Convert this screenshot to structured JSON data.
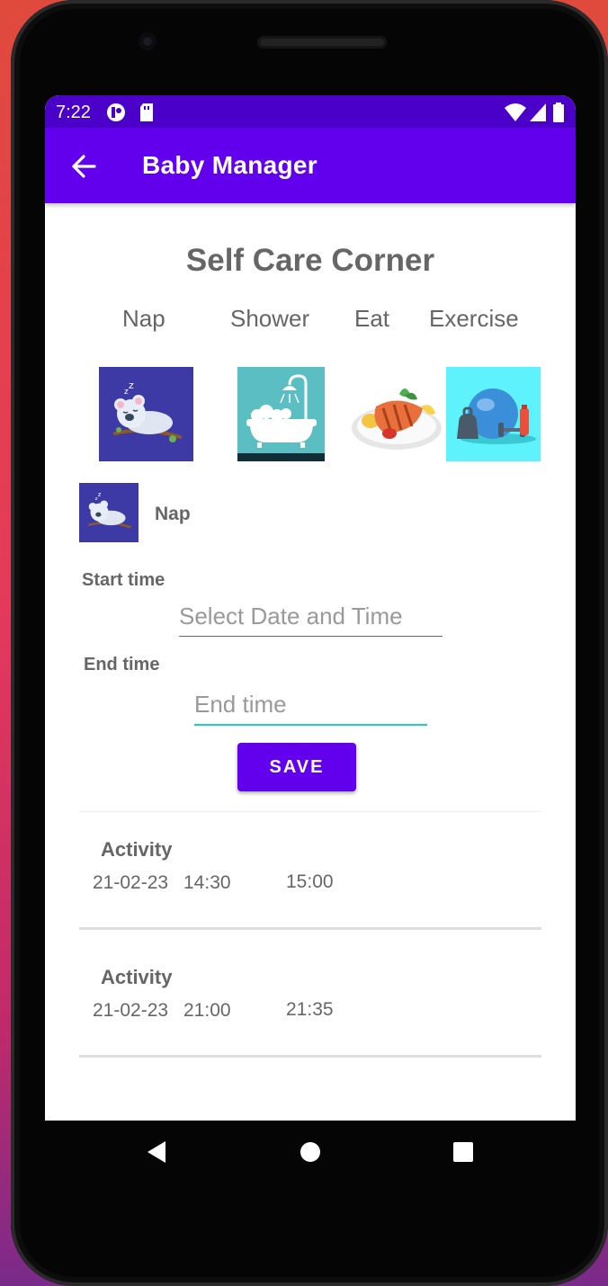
{
  "status_bar": {
    "time": "7:22"
  },
  "app_bar": {
    "title": "Baby Manager"
  },
  "heading": "Self Care Corner",
  "categories": [
    {
      "label": "Nap",
      "image": "sleeping-koala-image"
    },
    {
      "label": "Shower",
      "image": "bathtub-shower-image"
    },
    {
      "label": "Eat",
      "image": "salmon-plate-image"
    },
    {
      "label": "Exercise",
      "image": "gym-equipment-image"
    }
  ],
  "selected": {
    "label": "Nap",
    "image": "sleeping-koala-image"
  },
  "form": {
    "start_label": "Start time",
    "start_placeholder": "Select Date and Time",
    "end_label": "End time",
    "end_placeholder": "End time",
    "save_label": "SAVE"
  },
  "activities": [
    {
      "title": "Activity",
      "date": "21-02-23",
      "start": "14:30",
      "end": "15:00"
    },
    {
      "title": "Activity",
      "date": "21-02-23",
      "start": "21:00",
      "end": "21:35"
    }
  ],
  "colors": {
    "primary": "#6200ee",
    "status_bar": "#4a00c8",
    "accent": "#1fcfc6"
  },
  "nav_bar": {
    "icons": [
      "back-triangle-icon",
      "home-circle-icon",
      "recents-square-icon"
    ]
  }
}
